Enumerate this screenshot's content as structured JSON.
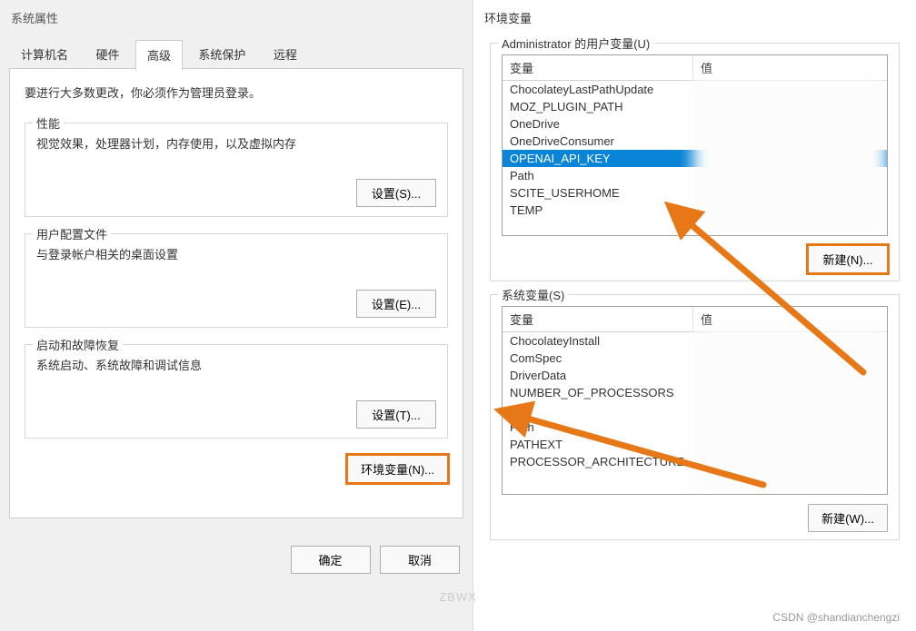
{
  "sysprop": {
    "title": "系统属性",
    "tabs": [
      "计算机名",
      "硬件",
      "高级",
      "系统保护",
      "远程"
    ],
    "active_tab": "高级",
    "intro": "要进行大多数更改，你必须作为管理员登录。",
    "perf": {
      "legend": "性能",
      "desc": "视觉效果，处理器计划，内存使用，以及虚拟内存",
      "btn": "设置(S)..."
    },
    "profile": {
      "legend": "用户配置文件",
      "desc": "与登录帐户相关的桌面设置",
      "btn": "设置(E)..."
    },
    "startup": {
      "legend": "启动和故障恢复",
      "desc": "系统启动、系统故障和调试信息",
      "btn": "设置(T)..."
    },
    "envbtn": "环境变量(N)...",
    "ok": "确定",
    "cancel": "取消"
  },
  "envvars": {
    "title": "环境变量",
    "user_legend": "Administrator 的用户变量(U)",
    "col_name": "变量",
    "col_value": "值",
    "user_vars": [
      "ChocolateyLastPathUpdate",
      "MOZ_PLUGIN_PATH",
      "OneDrive",
      "OneDriveConsumer",
      "OPENAI_API_KEY",
      "Path",
      "SCITE_USERHOME",
      "TEMP"
    ],
    "user_selected_index": 4,
    "user_new_btn": "新建(N)...",
    "sys_legend": "系统变量(S)",
    "sys_vars": [
      "ChocolateyInstall",
      "ComSpec",
      "DriverData",
      "NUMBER_OF_PROCESSORS",
      "OS",
      "Path",
      "PATHEXT",
      "PROCESSOR_ARCHITECTURE"
    ],
    "sys_new_btn": "新建(W)..."
  },
  "watermark_center": "ZBWX",
  "watermark_right": "CSDN @shandianchengzi"
}
